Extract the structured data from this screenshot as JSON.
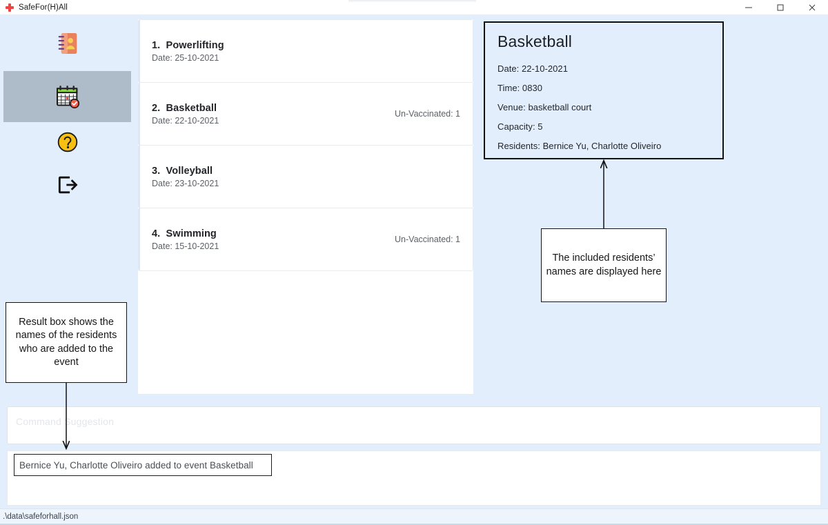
{
  "window": {
    "title": "SafeFor(H)All",
    "app_icon": "red-cross-icon",
    "controls": {
      "minimize": "minimize-icon",
      "maximize": "maximize-icon",
      "close": "close-icon"
    }
  },
  "sidebar": {
    "items": [
      {
        "icon": "address-book-icon",
        "name": "residents",
        "selected": false
      },
      {
        "icon": "calendar-check-icon",
        "name": "events",
        "selected": true
      },
      {
        "icon": "help-question-icon",
        "name": "help",
        "selected": false
      },
      {
        "icon": "logout-exit-icon",
        "name": "logout",
        "selected": false
      }
    ]
  },
  "event_list": {
    "items": [
      {
        "index": "1.",
        "title": "Powerlifting",
        "date": "Date: 25-10-2021",
        "badge": "",
        "selected": false
      },
      {
        "index": "2.",
        "title": "Basketball",
        "date": "Date: 22-10-2021",
        "badge": "Un-Vaccinated: 1",
        "selected": true
      },
      {
        "index": "3.",
        "title": "Volleyball",
        "date": "Date: 23-10-2021",
        "badge": "",
        "selected": false
      },
      {
        "index": "4.",
        "title": "Swimming",
        "date": "Date: 15-10-2021",
        "badge": "Un-Vaccinated: 1",
        "selected": false
      }
    ]
  },
  "detail": {
    "title": "Basketball",
    "rows": [
      "Date: 22-10-2021",
      "Time: 0830",
      "Venue: basketball court",
      "Capacity: 5",
      "Residents: Bernice Yu, Charlotte Oliveiro"
    ]
  },
  "command": {
    "placeholder": "Command Suggestion",
    "value": ""
  },
  "result": {
    "text": "Bernice Yu, Charlotte Oliveiro added to event Basketball"
  },
  "status": {
    "file_path": ".\\data\\safeforhall.json"
  },
  "annotations": {
    "left": "Result box shows the names of the residents who are added to the event",
    "right": "The included residents’ names are displayed here"
  },
  "colors": {
    "background": "#e2eefc",
    "sidebar_selected": "#aebbc8",
    "card_background": "#ffffff",
    "accent_red": "#ef4444",
    "help_yellow": "#f5bc10",
    "book_orange": "#e8805a"
  }
}
